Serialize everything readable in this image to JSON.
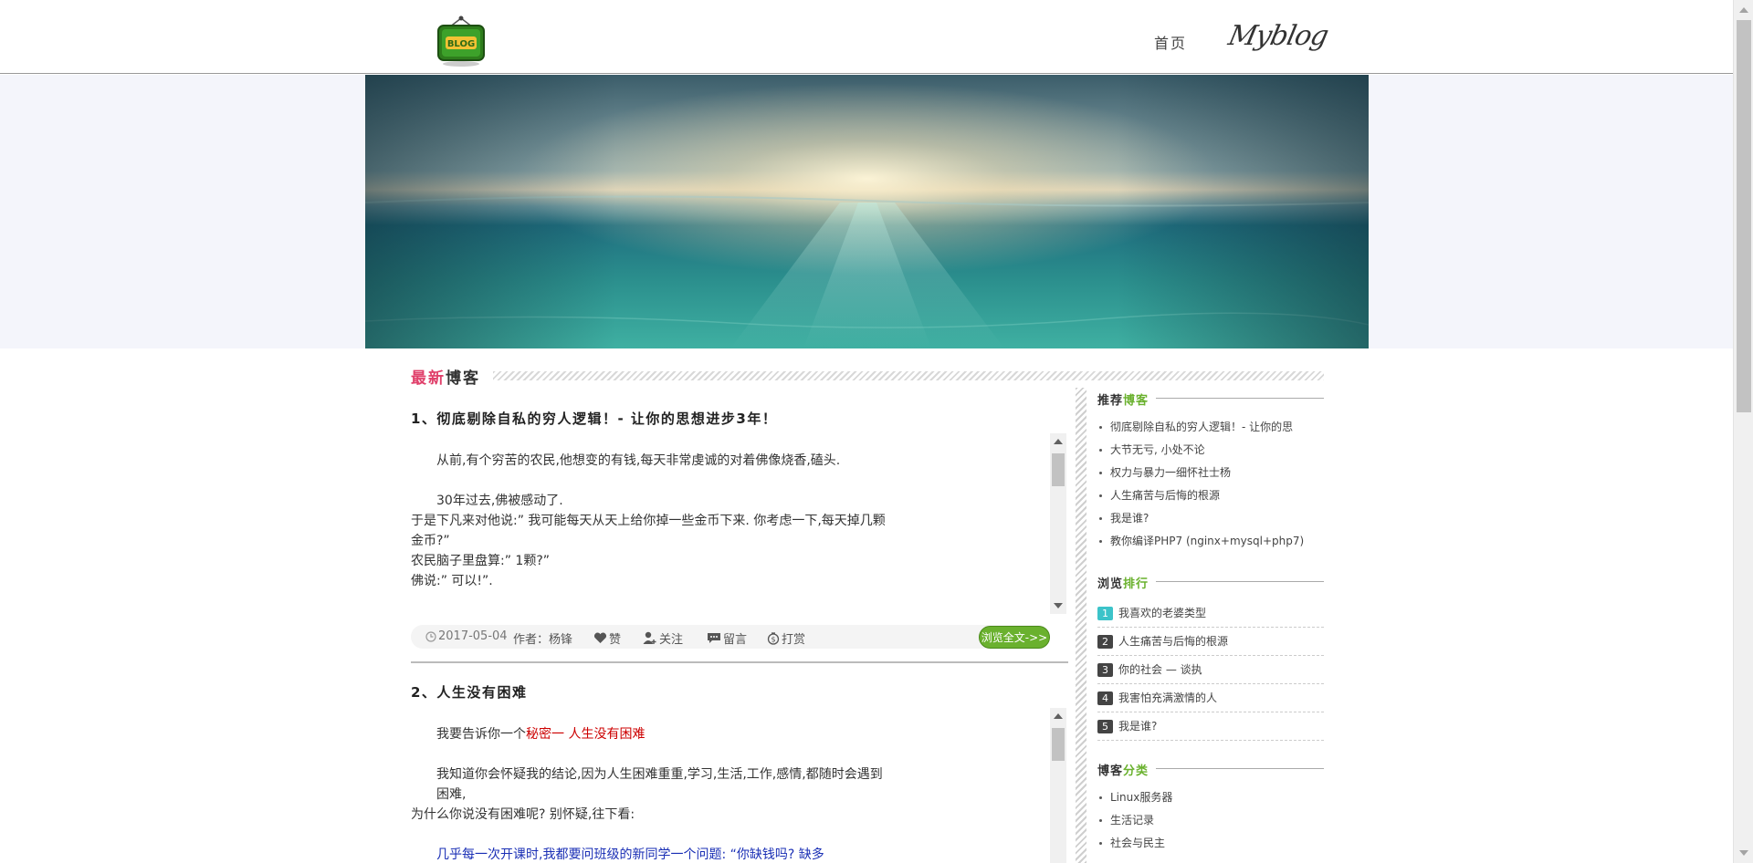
{
  "header": {
    "logo_text": "BLOG",
    "nav_home": "首页",
    "nav_myblog": "Myblog"
  },
  "section": {
    "title_highlight": "最新",
    "title_rest": "博客"
  },
  "articles": [
    {
      "title": "1、彻底剔除自私的穷人逻辑！- 让你的思想进步3年！",
      "paragraphs": [
        "从前,有个穷苦的农民,他想变的有钱,每天非常虔诚的对着佛像烧香,磕头.",
        "30年过去,佛被感动了.",
        "于是下凡来对他说:” 我可能每天从天上给你掉一些金币下来. 你考虑一下,每天掉几颗金币?”",
        "农民脑子里盘算:” 1颗?”",
        "佛说:” 可以!”."
      ],
      "meta": {
        "date": "2017-05-04",
        "author": "作者：杨锋",
        "like": "赞",
        "follow": "关注",
        "comment": "留言",
        "reward": "打赏"
      },
      "read_more": "浏览全文->>"
    },
    {
      "title": "2、人生没有困难",
      "p1_prefix": "我要告诉你一个",
      "p1_red": "秘密一 人生没有困难",
      "p2": "我知道你会怀疑我的结论,因为人生困难重重,学习,生活,工作,感情,都随时会遇到困难,",
      "p3": "为什么你说没有困难呢? 别怀疑,往下看:",
      "p4_blue": "几乎每一次开课时,我都要问班级的新同学一个问题: “你缺钱吗? 缺多"
    }
  ],
  "sidebar": {
    "recommend": {
      "title_a": "推荐",
      "title_b": "博客",
      "items": [
        "彻底剔除自私的穷人逻辑！- 让你的思",
        "大节无亏, 小处不论",
        "权力与暴力一细怀社士杨",
        "人生痛苦与后悔的根源",
        "我是谁?",
        "教你编译PHP7 (nginx+mysql+php7)"
      ]
    },
    "ranking": {
      "title_a": "浏览",
      "title_b": "排行",
      "items": [
        {
          "num": "1",
          "text": "我喜欢的老婆类型"
        },
        {
          "num": "2",
          "text": "人生痛苦与后悔的根源"
        },
        {
          "num": "3",
          "text": "你的社会 — 谈执"
        },
        {
          "num": "4",
          "text": "我害怕充满激情的人"
        },
        {
          "num": "5",
          "text": "我是谁?"
        }
      ]
    },
    "category": {
      "title_a": "博客",
      "title_b": "分类",
      "items": [
        "Linux服务器",
        "生活记录",
        "社会与民主"
      ]
    }
  },
  "colors": {
    "accent_pink": "#e0406b",
    "accent_green": "#6ab12e",
    "rank_first": "#3cc3c9",
    "link_red": "#cc0000",
    "link_blue": "#1a2fb5"
  }
}
